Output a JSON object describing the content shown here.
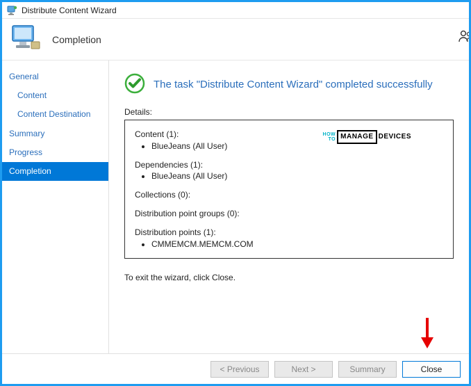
{
  "window": {
    "title": "Distribute Content Wizard"
  },
  "header": {
    "page_title": "Completion"
  },
  "sidebar": {
    "items": [
      {
        "label": "General",
        "indent": false,
        "selected": false
      },
      {
        "label": "Content",
        "indent": true,
        "selected": false
      },
      {
        "label": "Content Destination",
        "indent": true,
        "selected": false
      },
      {
        "label": "Summary",
        "indent": false,
        "selected": false
      },
      {
        "label": "Progress",
        "indent": false,
        "selected": false
      },
      {
        "label": "Completion",
        "indent": false,
        "selected": true
      }
    ]
  },
  "main": {
    "status_message": "The task \"Distribute Content Wizard\" completed successfully",
    "details_label": "Details:",
    "details": {
      "content_header": "Content (1):",
      "content_item": "BlueJeans (All User)",
      "dependencies_header": "Dependencies (1):",
      "dependencies_item": "BlueJeans (All User)",
      "collections_header": "Collections (0):",
      "dpgroups_header": "Distribution point groups (0):",
      "dpoints_header": "Distribution points (1):",
      "dpoints_item": "CMMEMCM.MEMCM.COM"
    },
    "exit_instruction": "To exit the wizard, click Close."
  },
  "footer": {
    "previous": "< Previous",
    "next": "Next >",
    "summary": "Summary",
    "close": "Close"
  },
  "watermark": {
    "a": "HOW",
    "b": "TO",
    "c": "MANAGE",
    "d": "DEVICES"
  }
}
